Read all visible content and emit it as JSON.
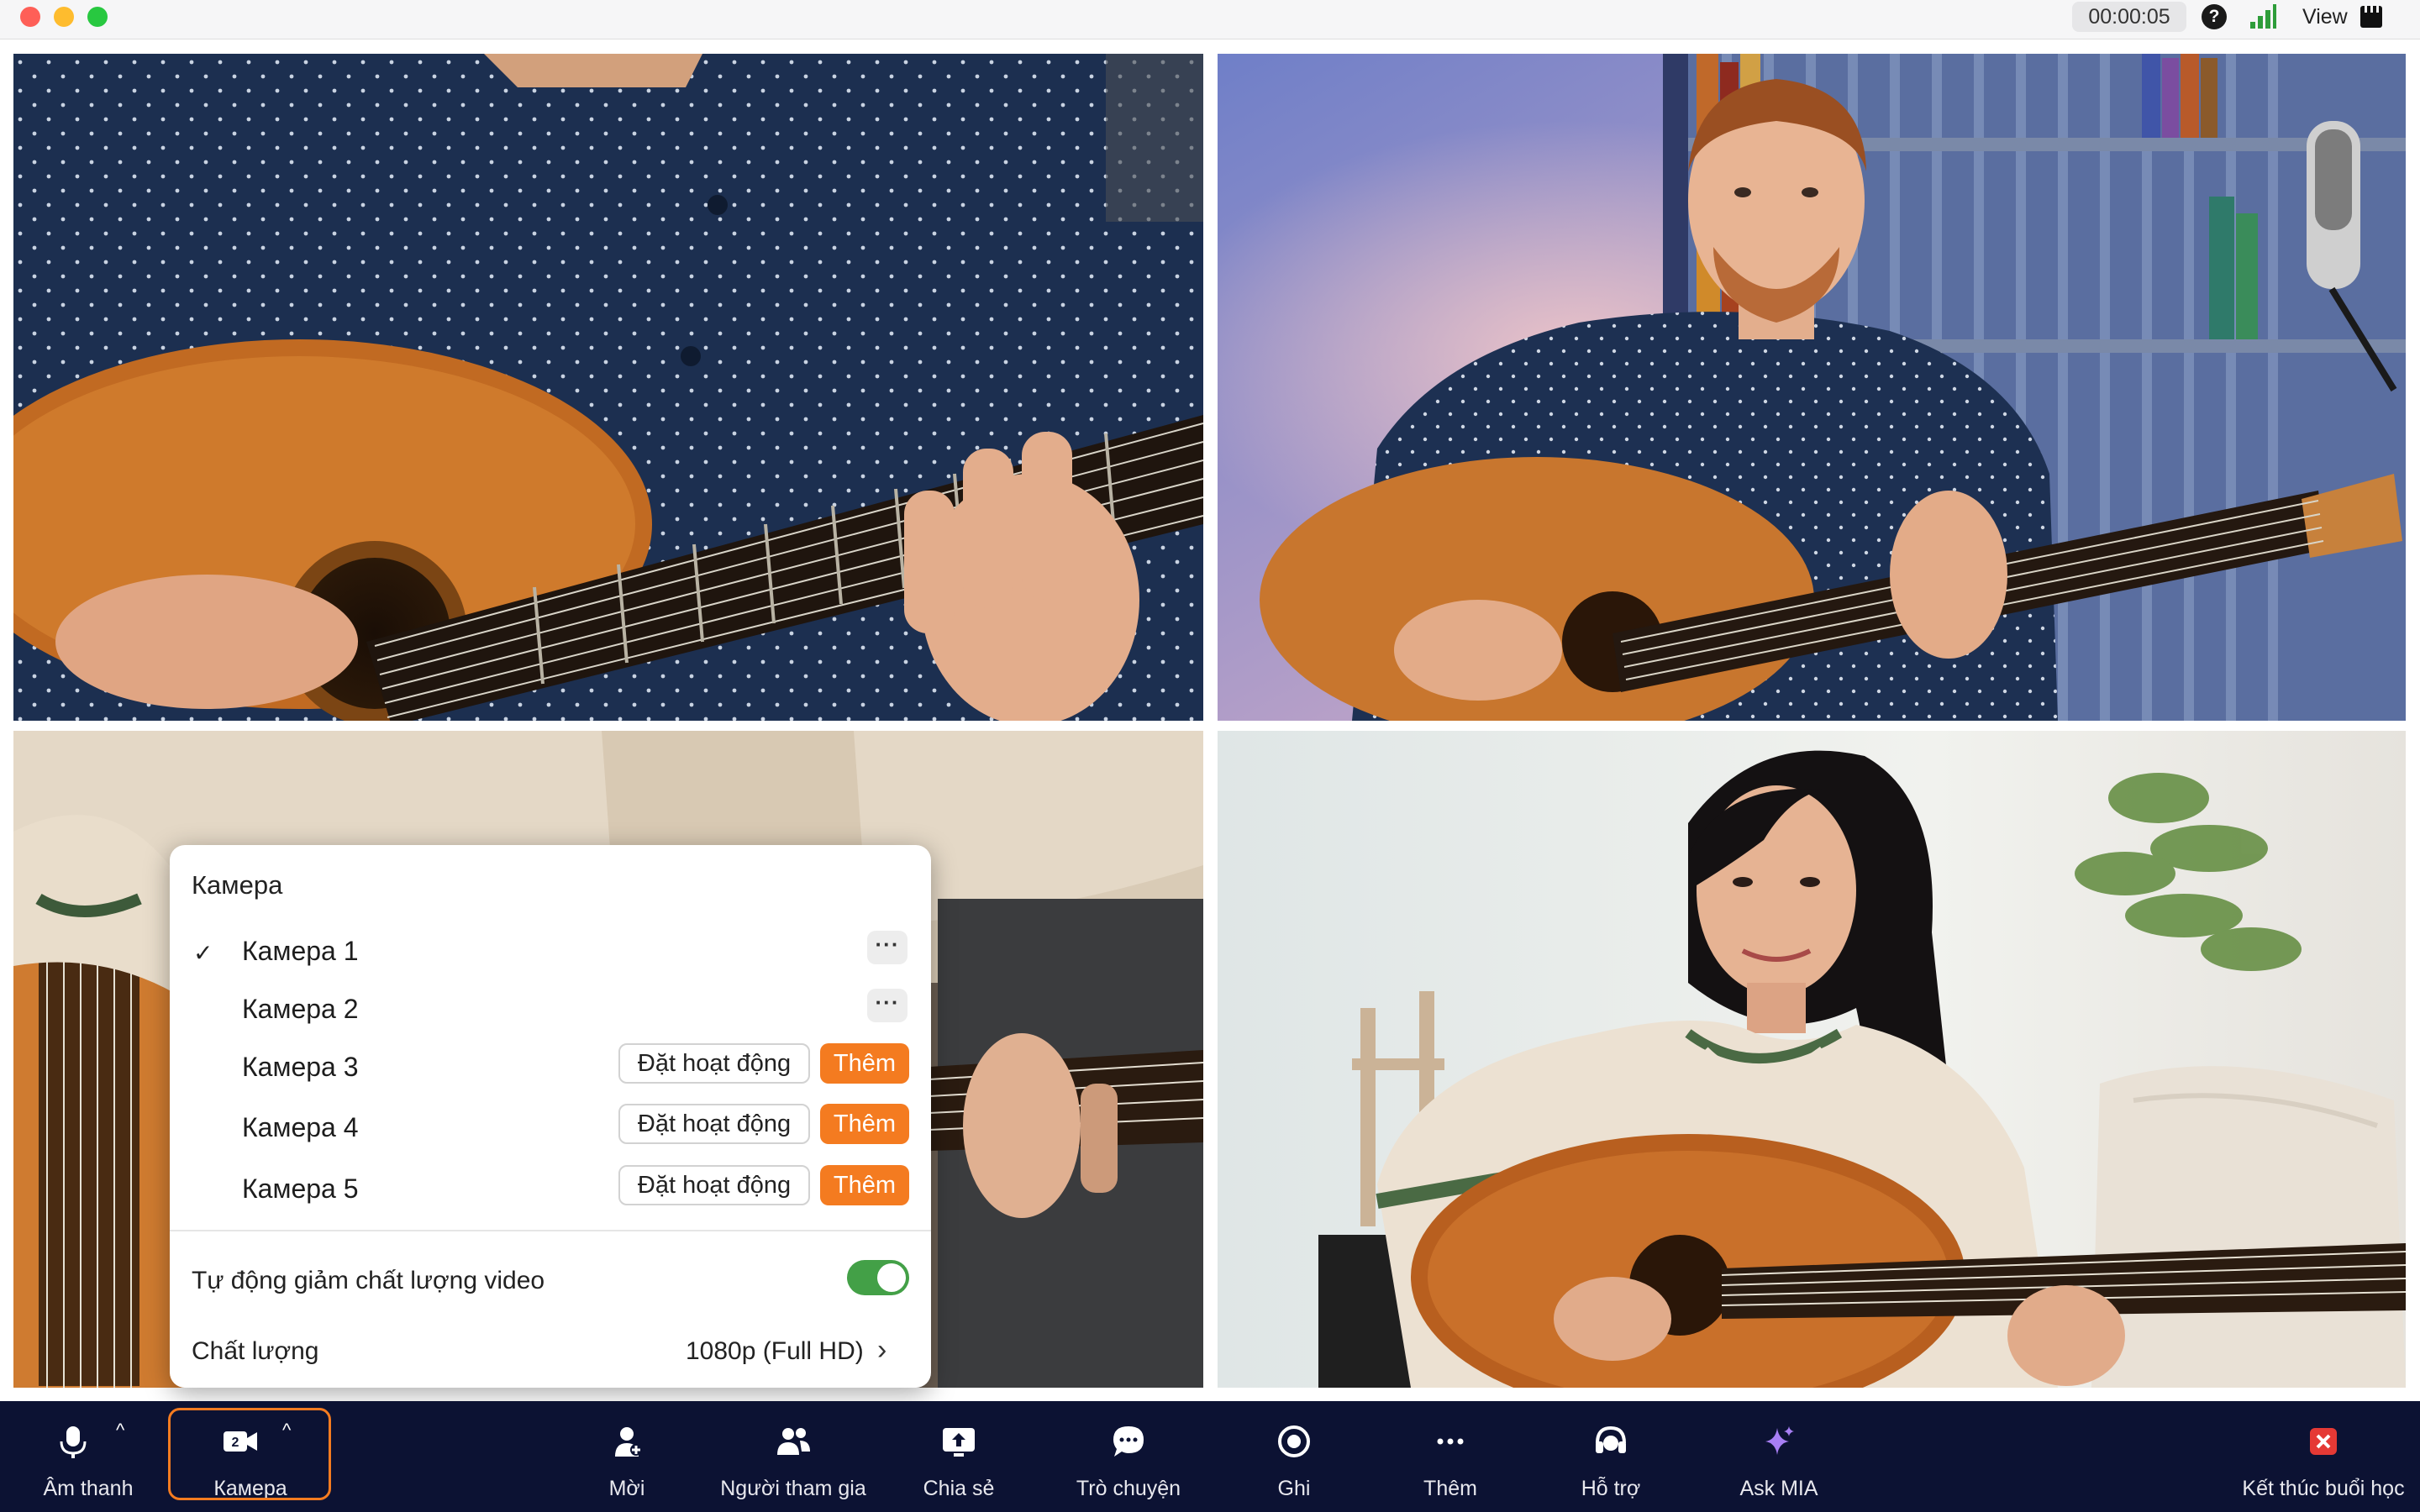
{
  "window": {
    "timer": "00:00:05",
    "view_label": "View",
    "icons": [
      "help-icon",
      "signal-icon",
      "layout-icon"
    ]
  },
  "camera_menu": {
    "title": "Камера",
    "cameras": [
      {
        "name": "Камера 1",
        "selected": true,
        "actions": "more"
      },
      {
        "name": "Камера 2",
        "selected": false,
        "actions": "more"
      },
      {
        "name": "Камера 3",
        "selected": false,
        "activate_label": "Đặt hoạt động",
        "add_label": "Thêm"
      },
      {
        "name": "Камера 4",
        "selected": false,
        "activate_label": "Đặt hoạt động",
        "add_label": "Thêm"
      },
      {
        "name": "Камера 5",
        "selected": false,
        "activate_label": "Đặt hoạt động",
        "add_label": "Thêm"
      }
    ],
    "check_mark": "✓",
    "more_dots": "···",
    "auto_reduce_label": "Tự động giảm chất lượng video",
    "auto_reduce_on": true,
    "quality_label": "Chất lượng",
    "quality_value": "1080p (Full HD)",
    "chevron": "›"
  },
  "toolbar": {
    "audio": {
      "label": "Âm thanh",
      "icon": "microphone-icon"
    },
    "camera": {
      "label": "Камера",
      "icon": "camera-icon",
      "badge": "2"
    },
    "invite": {
      "label": "Mời",
      "icon": "invite-icon"
    },
    "participants": {
      "label": "Người tham gia",
      "icon": "participants-icon"
    },
    "share": {
      "label": "Chia sẻ",
      "icon": "share-icon"
    },
    "chat": {
      "label": "Trò chuyện",
      "icon": "chat-icon"
    },
    "record": {
      "label": "Ghi",
      "icon": "record-icon"
    },
    "more": {
      "label": "Thêm",
      "icon": "more-icon"
    },
    "support": {
      "label": "Hỗ trợ",
      "icon": "support-icon"
    },
    "ask_mia": {
      "label": "Ask MIA",
      "icon": "sparkle-icon"
    },
    "end": {
      "label": "Kết thúc buổi học",
      "icon": "close-icon"
    },
    "caret": "^"
  },
  "colors": {
    "accent_orange": "#f47b20",
    "toolbar_bg": "#0c1233",
    "toggle_green": "#43a047",
    "end_red": "#e53935",
    "ask_mia_purple": "#a87ff5"
  }
}
